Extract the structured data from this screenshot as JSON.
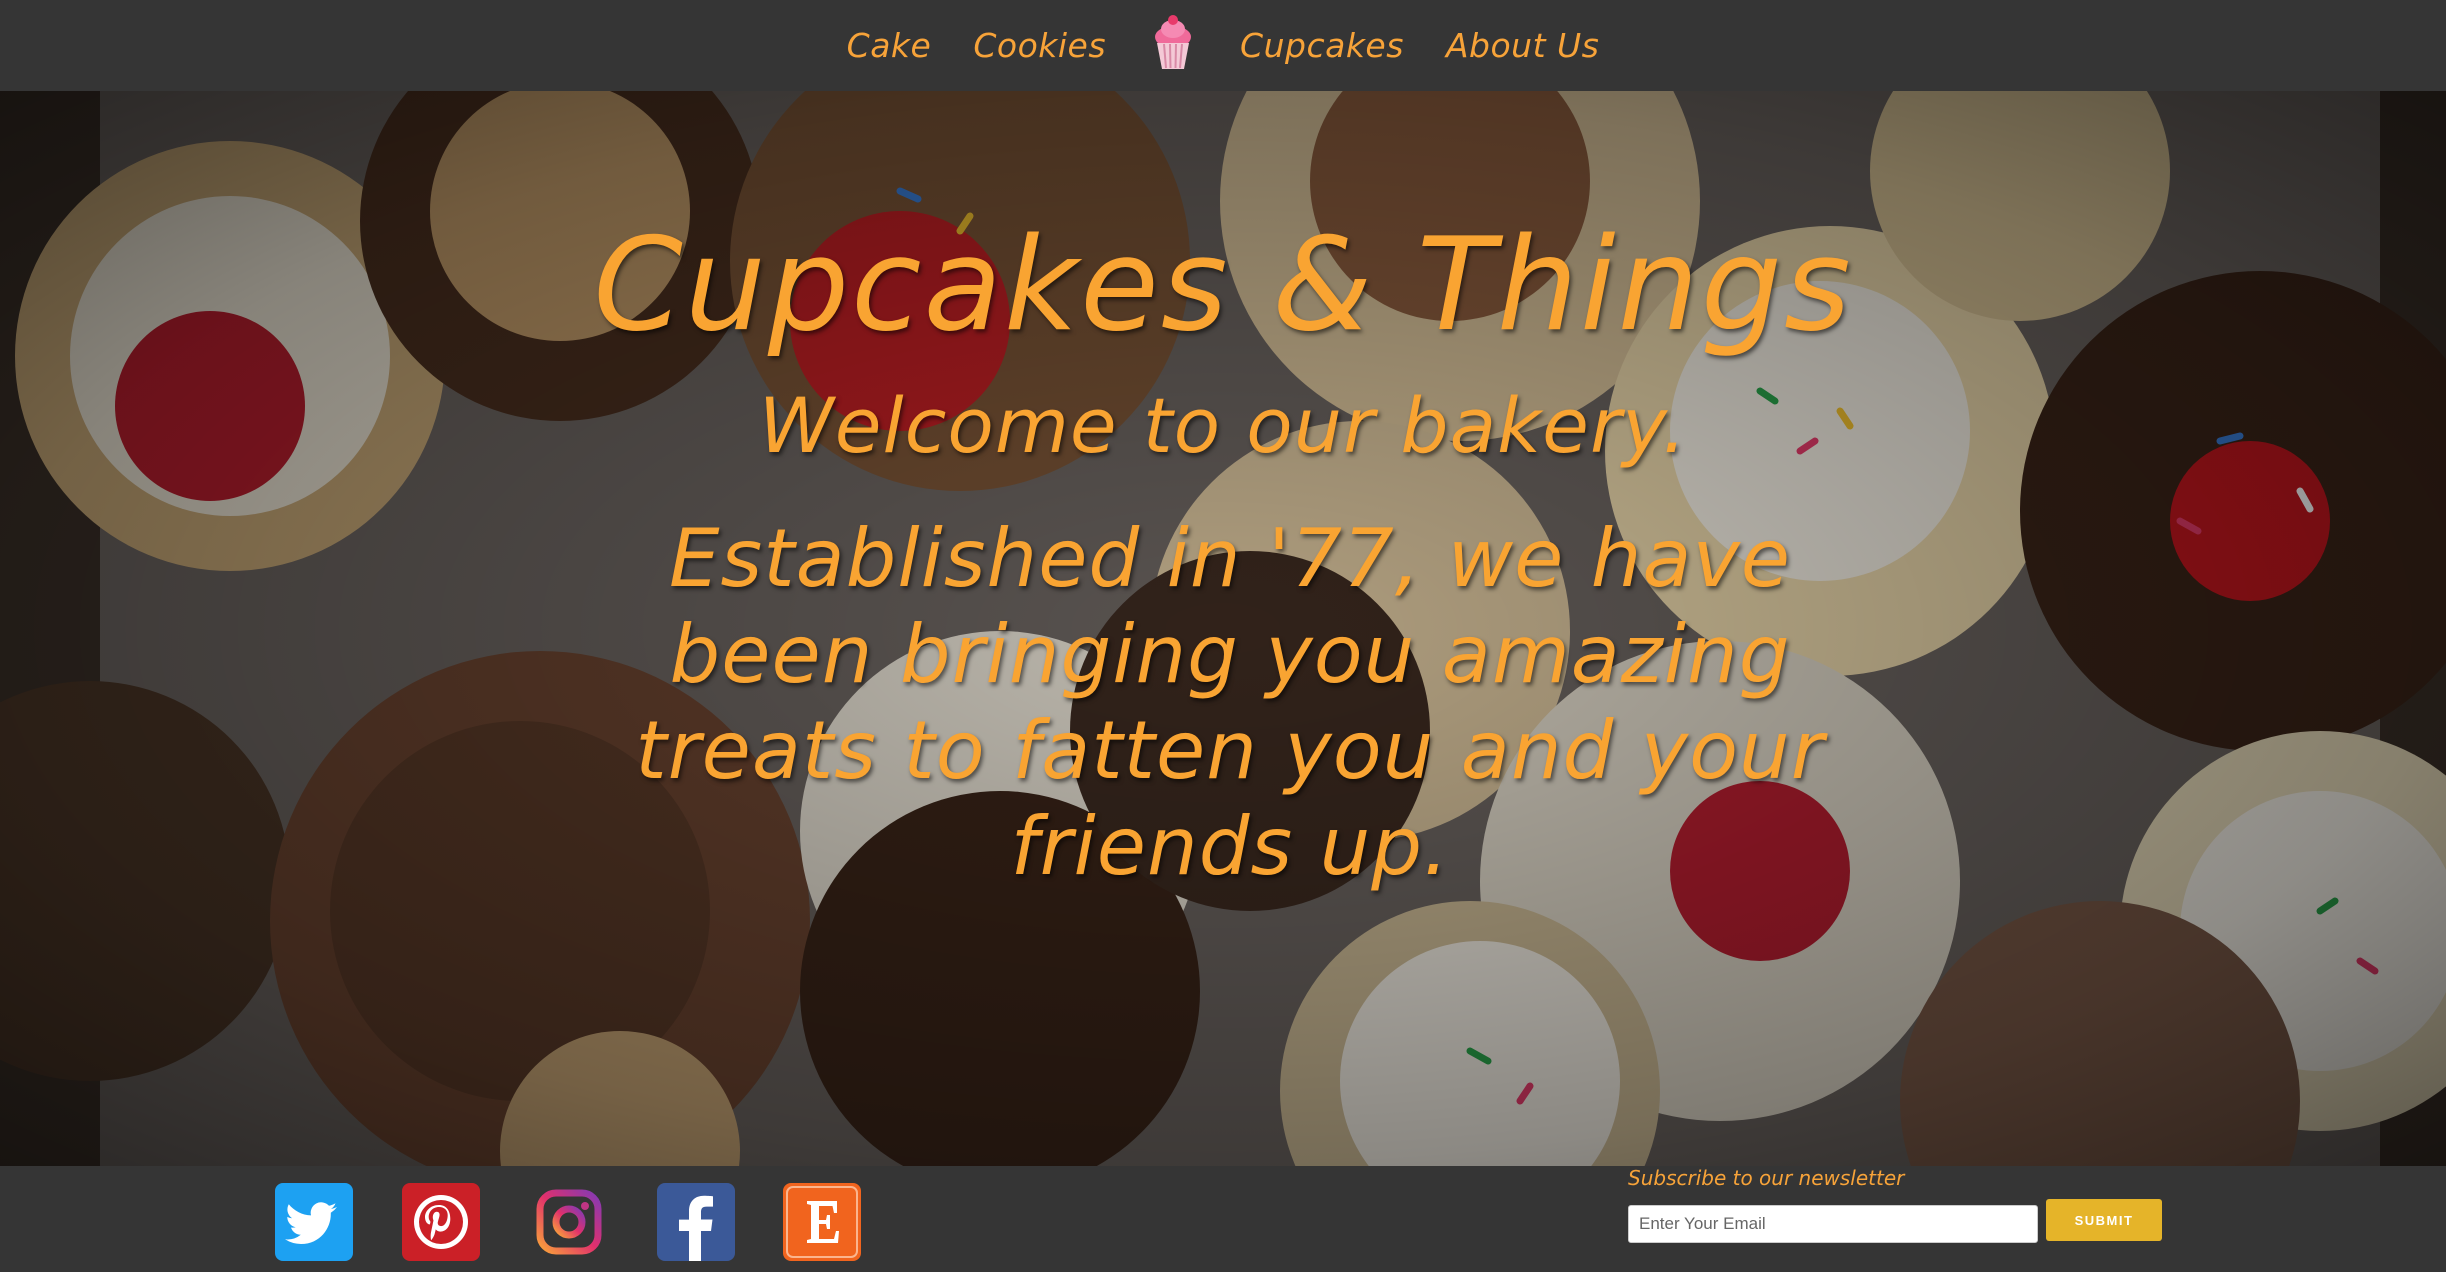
{
  "nav": {
    "links": [
      "Cake",
      "Cookies",
      "Cupcakes",
      "About Us"
    ],
    "logo_icon": "cupcake-icon"
  },
  "hero": {
    "title": "Cupcakes & Things",
    "subtitle": "Welcome to our bakery.",
    "body": "Established in '77, we have been bringing you amazing treats to fatten you and your friends up."
  },
  "footer": {
    "social": [
      {
        "icon": "twitter-icon",
        "color": "#1da1f2"
      },
      {
        "icon": "pinterest-icon",
        "color": "#cb2027"
      },
      {
        "icon": "instagram-icon",
        "color": "#c13584"
      },
      {
        "icon": "facebook-icon",
        "color": "#3b5998"
      },
      {
        "icon": "etsy-icon",
        "color": "#f1641e"
      }
    ],
    "newsletter_label": "Subscribe to our newsletter",
    "email_placeholder": "Enter Your Email",
    "submit_label": "SUBMIT"
  },
  "colors": {
    "accent": "#f9a432",
    "bar": "#353535",
    "button": "#e5b429"
  }
}
